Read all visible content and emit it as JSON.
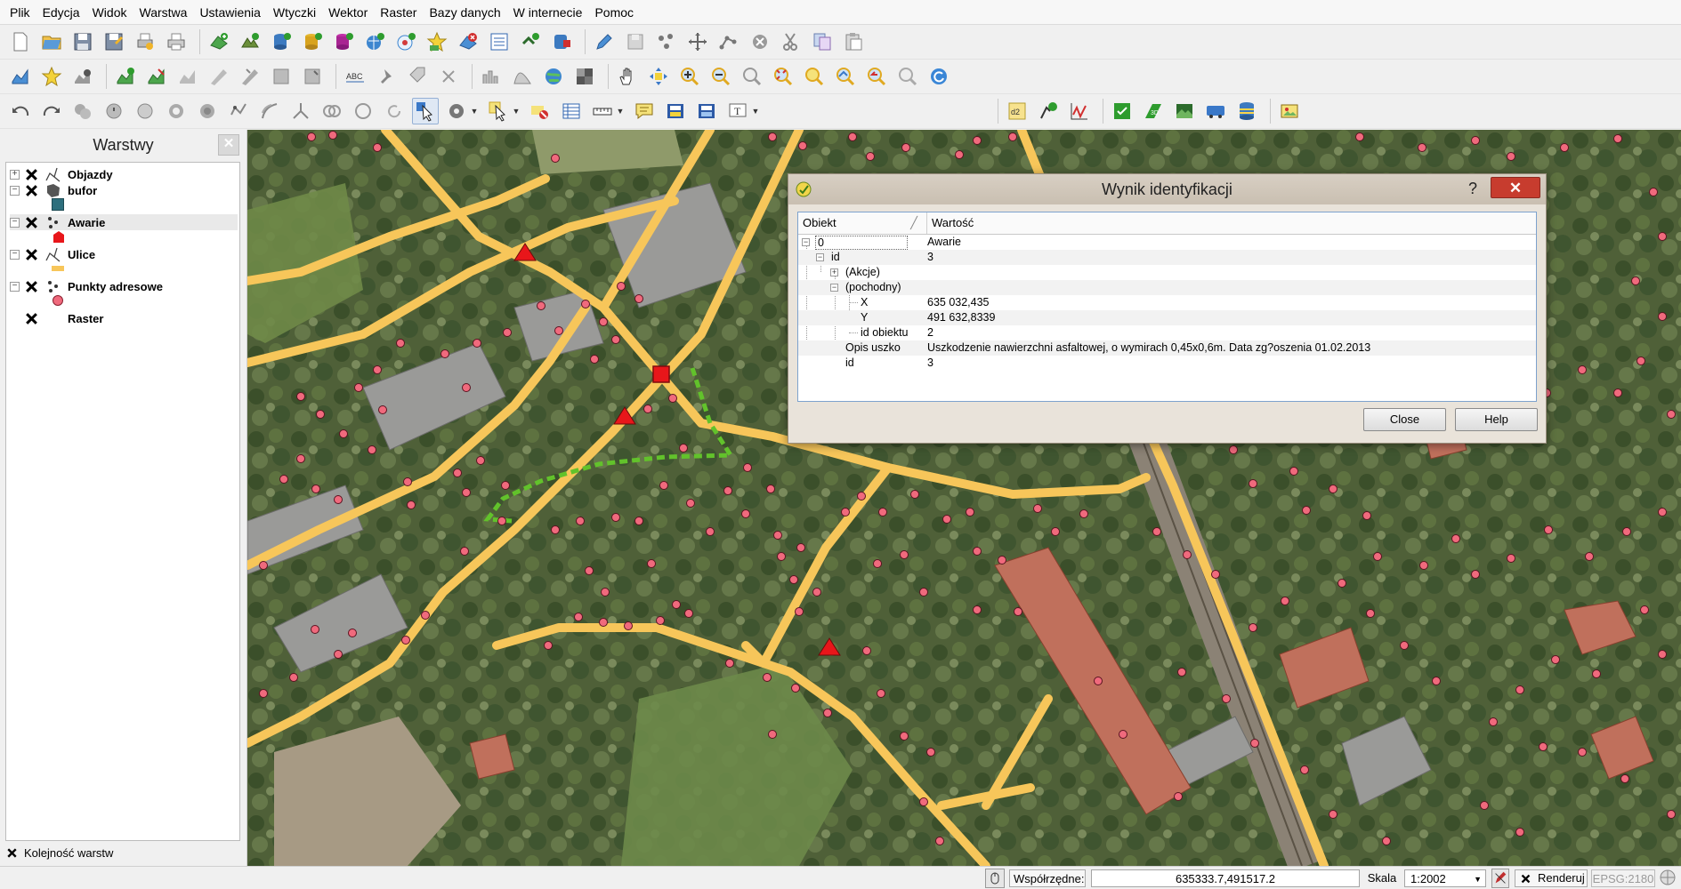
{
  "menu": [
    "Plik",
    "Edycja",
    "Widok",
    "Warstwa",
    "Ustawienia",
    "Wtyczki",
    "Wektor",
    "Raster",
    "Bazy danych",
    "W internecie",
    "Pomoc"
  ],
  "layers_panel": {
    "title": "Warstwy",
    "layers": [
      {
        "name": "Objazdy",
        "symbol": "line-green-dashed"
      },
      {
        "name": "bufor",
        "symbol": "polygon-teal"
      },
      {
        "name": "Awarie",
        "symbol": "point-red"
      },
      {
        "name": "Ulice",
        "symbol": "line-yellow"
      },
      {
        "name": "Punkty adresowe",
        "symbol": "point-pink"
      },
      {
        "name": "Raster",
        "symbol": "raster"
      }
    ],
    "layer_order_label": "Kolejność warstw"
  },
  "dialog": {
    "title": "Wynik identyfikacji",
    "help_glyph": "?",
    "close_glyph": "✕",
    "columns": [
      "Obiekt",
      "Wartość"
    ],
    "rows": {
      "r0": {
        "key": "0",
        "value": "Awarie"
      },
      "r1": {
        "key": "id",
        "value": "3"
      },
      "r2": {
        "key": "(Akcje)",
        "value": ""
      },
      "r3": {
        "key": "(pochodny)",
        "value": ""
      },
      "r4": {
        "key": "X",
        "value": "635 032,435"
      },
      "r5": {
        "key": "Y",
        "value": "491 632,8339"
      },
      "r6": {
        "key": "id obiektu",
        "value": "2"
      },
      "r7": {
        "key": "Opis uszko",
        "value": "Uszkodzenie nawierzchni asfaltowej, o wymirach 0,45x0,6m. Data zg?oszenia 01.02.2013"
      },
      "r8": {
        "key": "id",
        "value": "3"
      }
    },
    "close_button": "Close",
    "help_button": "Help"
  },
  "statusbar": {
    "coords_label": "Współrzędne:",
    "coords_value": "635333.7,491517.2",
    "scale_label": "Skala",
    "scale_value": "1:2002",
    "render_label": "Renderuj",
    "crs": "EPSG:2180"
  },
  "colors": {
    "street": "#f7c65a",
    "detour": "#62c22b",
    "incident": "#e8161a",
    "address_point": "#f06a7d"
  }
}
